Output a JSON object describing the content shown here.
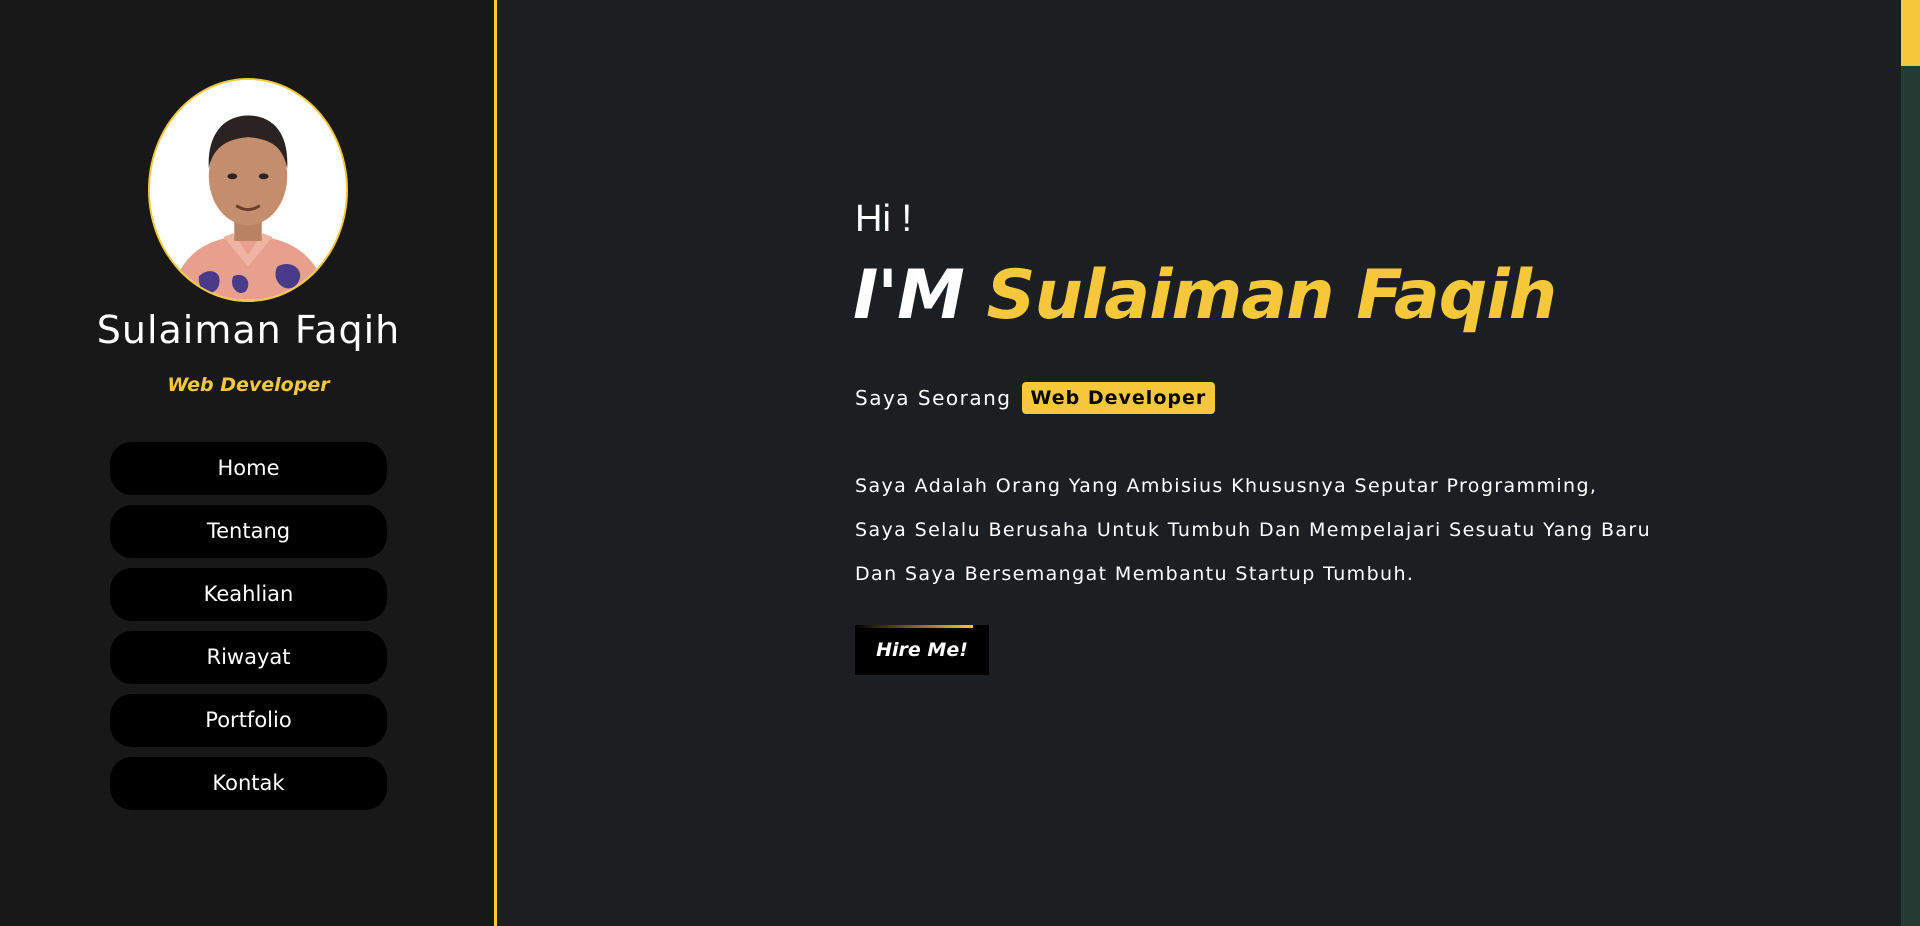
{
  "colors": {
    "accent": "#f5c83b",
    "sidebar_bg": "#181818",
    "main_bg": "#1b1f21",
    "button_bg": "#000000",
    "text": "#ffffff"
  },
  "profile": {
    "name": "Sulaiman Faqih",
    "role": "Web Developer",
    "avatar_icon": "profile-photo"
  },
  "nav": {
    "items": [
      {
        "label": "Home"
      },
      {
        "label": "Tentang"
      },
      {
        "label": "Keahlian"
      },
      {
        "label": "Riwayat"
      },
      {
        "label": "Portfolio"
      },
      {
        "label": "Kontak"
      }
    ]
  },
  "hero": {
    "greeting": "Hi !",
    "im": "I'M",
    "name": "Sulaiman Faqih",
    "intro_prefix": "Saya Seorang",
    "intro_role": "Web Developer",
    "description_lines": [
      "Saya Adalah Orang Yang Ambisius Khususnya Seputar Programming,",
      "Saya Selalu Berusaha Untuk Tumbuh Dan Mempelajari Sesuatu Yang Baru",
      "Dan Saya Bersemangat Membantu Startup Tumbuh."
    ],
    "cta_label": "Hire Me!"
  }
}
